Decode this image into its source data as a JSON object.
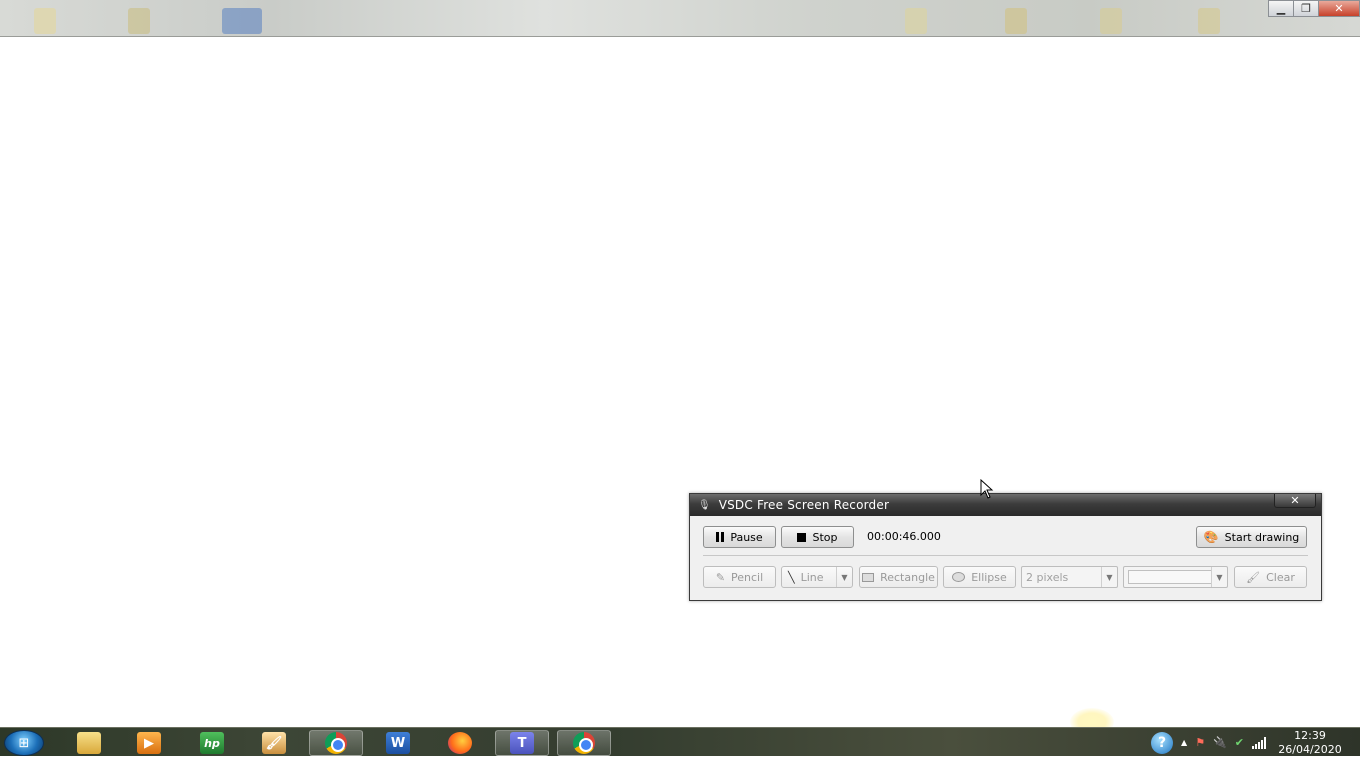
{
  "window": {
    "controls": {
      "minimize_icon": "minimize-icon",
      "restore_icon": "restore-icon",
      "close_icon": "close-icon"
    }
  },
  "recorder": {
    "title": "VSDC Free Screen Recorder",
    "close_glyph": "✕",
    "pause_label": "Pause",
    "stop_label": "Stop",
    "timer": "00:00:46.000",
    "start_drawing_label": "Start drawing",
    "tools": {
      "pencil_label": "Pencil",
      "line_label": "Line",
      "rectangle_label": "Rectangle",
      "ellipse_label": "Ellipse",
      "thickness_value": "2 pixels",
      "clear_label": "Clear"
    }
  },
  "taskbar": {
    "apps": [
      {
        "name": "file-explorer-icon",
        "active": false
      },
      {
        "name": "media-player-icon",
        "active": false
      },
      {
        "name": "hp-icon",
        "active": false
      },
      {
        "name": "paint-icon",
        "active": false
      },
      {
        "name": "chrome-icon",
        "active": true
      },
      {
        "name": "word-icon",
        "active": false
      },
      {
        "name": "firefox-icon",
        "active": false
      },
      {
        "name": "teams-icon",
        "active": false
      },
      {
        "name": "chrome-icon",
        "active": true
      }
    ],
    "word_glyph": "W",
    "teams_glyph": "T",
    "hp_glyph": "hp",
    "clock_time": "12:39",
    "clock_date": "26/04/2020",
    "help_glyph": "?",
    "tray_expand_glyph": "▲"
  },
  "colors": {
    "recorder_title_bg": "#3c3c3c",
    "dialog_bg": "#f0f0f0",
    "taskbar_bg": "#3d4636"
  }
}
